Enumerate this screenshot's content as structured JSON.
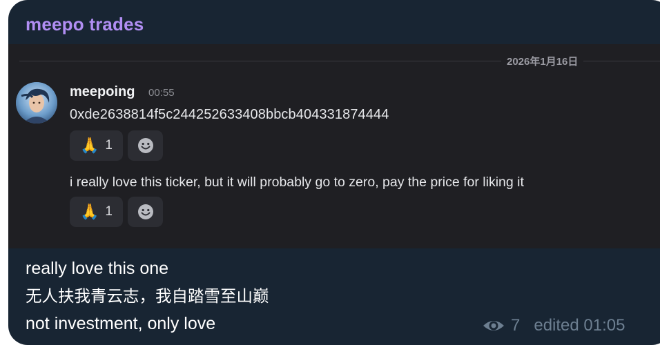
{
  "channel": {
    "name": "meepo trades"
  },
  "embed": {
    "date": "2026年1月16日",
    "author": {
      "username": "meepoing",
      "time": "00:55"
    },
    "messages": [
      {
        "text": "0xde2638814f5c244252633408bbcb404331874444",
        "reaction": {
          "emoji": "🙏",
          "icon": "folded-hands",
          "count": "1"
        }
      },
      {
        "text": "i really love this ticker, but it will probably go to zero, pay the price for liking it",
        "reaction": {
          "emoji": "🙏",
          "icon": "folded-hands",
          "count": "1"
        }
      }
    ]
  },
  "post": {
    "caption_lines": [
      "really love this one",
      "无人扶我青云志，我自踏雪至山巅",
      "not investment, only love"
    ],
    "views": "7",
    "edited": "edited 01:05"
  },
  "colors": {
    "bubble_bg": "#182533",
    "embed_bg": "#1f1f23",
    "channel_name": "#b18ef3",
    "meta_text": "#6d7f91"
  }
}
